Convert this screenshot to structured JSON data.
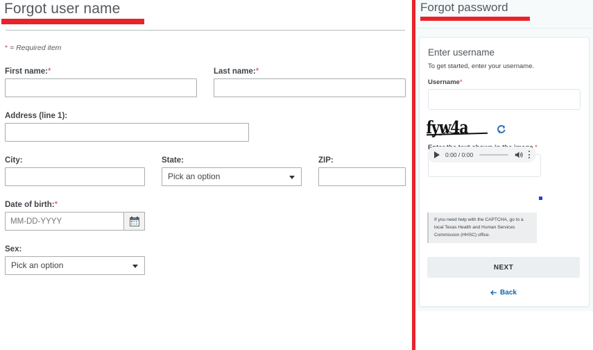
{
  "left": {
    "title": "Forgot user name",
    "required_note_star": "*",
    "required_note": "= Required item",
    "fields": {
      "first_name": {
        "label": "First name:",
        "required": "*",
        "value": ""
      },
      "last_name": {
        "label": "Last name:",
        "required": "*",
        "value": ""
      },
      "address1": {
        "label": "Address (line 1):",
        "value": ""
      },
      "city": {
        "label": "City:",
        "value": ""
      },
      "state": {
        "label": "State:",
        "value": "Pick an option"
      },
      "zip": {
        "label": "ZIP:",
        "value": ""
      },
      "dob": {
        "label": "Date of birth:",
        "required": "*",
        "placeholder": "MM-DD-YYYY",
        "value": ""
      },
      "sex": {
        "label": "Sex:",
        "value": "Pick an option"
      }
    },
    "icons": {
      "calendar": "calendar-icon",
      "dropdown": "chevron-down-icon"
    }
  },
  "right": {
    "title": "Forgot password",
    "card": {
      "heading": "Enter username",
      "subheading": "To get started, enter your username.",
      "username_label": "Username",
      "username_required": "*",
      "username_value": "",
      "captcha_text": "fyw4a",
      "refresh_icon": "refresh-icon",
      "audio": {
        "play_icon": "play-icon",
        "time": "0:00 / 0:00",
        "volume_icon": "volume-icon",
        "menu_icon": "kebab-menu-icon"
      },
      "captcha_input_label": "Enter the text shown in the image",
      "captcha_input_required": "*",
      "captcha_input_value": "",
      "help_text": "If you need help with the CAPTCHA, go to a local Texas Health and Human Services Commission (HHSC) office.",
      "next_label": "NEXT",
      "back_label": "Back",
      "back_icon": "arrow-left-icon"
    }
  },
  "colors": {
    "brand_red": "#e8232a",
    "label_gray": "#3f4347",
    "title_gray": "#54595e",
    "required_red": "#d73b3b",
    "link_blue": "#1565a8",
    "panel_tint": "#f7fafb"
  }
}
